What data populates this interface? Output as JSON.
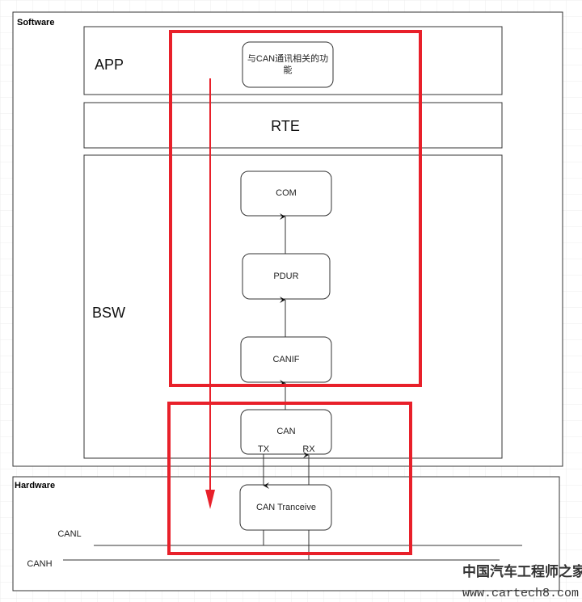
{
  "software": {
    "title": "Software",
    "app": "APP",
    "rte": "RTE",
    "bsw": "BSW"
  },
  "modules": {
    "app_func": [
      "与CAN通讯相关的功",
      "能"
    ],
    "com": "COM",
    "pdur": "PDUR",
    "canif": "CANIF",
    "can": "CAN",
    "tx": "TX",
    "rx": "RX"
  },
  "hardware": {
    "title": "Hardware",
    "transceiver": "CAN Tranceive",
    "canl": "CANL",
    "canh": "CANH"
  },
  "watermark": {
    "cn": "中国汽车工程师之家",
    "url": "www.cartech8.com"
  },
  "colors": {
    "highlight": "#e8202a",
    "grid": "#ececec"
  }
}
